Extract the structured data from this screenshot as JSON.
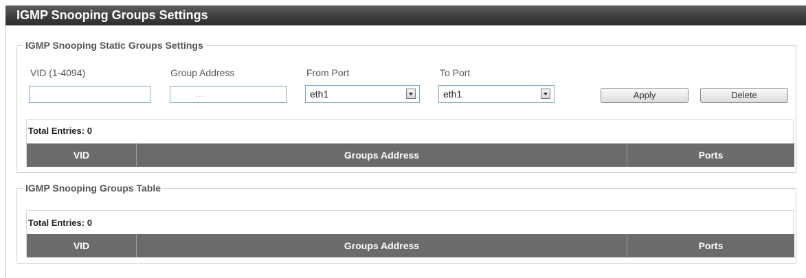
{
  "page": {
    "title": "IGMP Snooping Groups Settings"
  },
  "static_groups": {
    "legend": "IGMP Snooping Static Groups Settings",
    "vid_label": "VID (1-4094)",
    "vid_value": "",
    "group_address_label": "Group Address",
    "group_address_dots": ".   .   .",
    "from_port_label": "From Port",
    "from_port_value": "eth1",
    "to_port_label": "To Port",
    "to_port_value": "eth1",
    "apply_label": "Apply",
    "delete_label": "Delete",
    "total_entries": "Total Entries: 0",
    "columns": [
      "VID",
      "Groups Address",
      "Ports"
    ]
  },
  "groups_table": {
    "legend": "IGMP Snooping Groups Table",
    "total_entries": "Total Entries: 0",
    "columns": [
      "VID",
      "Groups Address",
      "Ports"
    ]
  }
}
